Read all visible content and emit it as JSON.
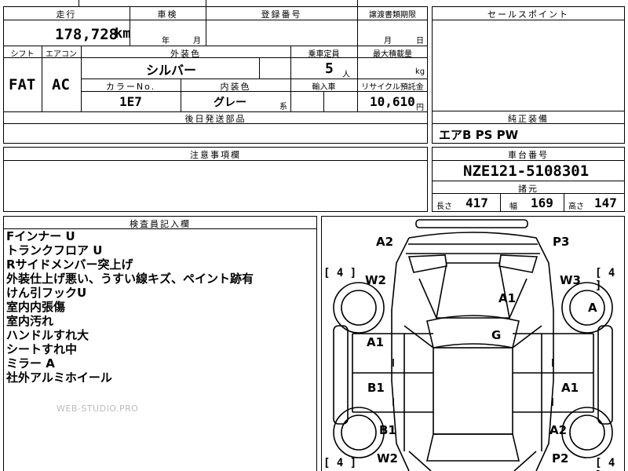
{
  "sheet": {
    "mileage_header": "走行",
    "mileage_value": "178,728",
    "mileage_unit": "km",
    "inspection_header": "車検",
    "inspection_year": "年",
    "inspection_month": "月",
    "plate_header": "登録番号",
    "transfer_header": "譲渡書類期限",
    "transfer_month": "月",
    "transfer_day": "日",
    "shift_header": "シフト",
    "shift_value": "FAT",
    "aircon_header": "エアコン",
    "aircon_value": "AC",
    "exterior_color_header": "外装色",
    "exterior_color_value": "シルバー",
    "capacity_header": "乗車定員",
    "capacity_value": "5",
    "capacity_unit": "人",
    "max_load_header": "最大積載量",
    "max_load_unit": "kg",
    "color_no_header": "カラーNo.",
    "color_no_value": "1E7",
    "interior_color_header": "内装色",
    "interior_color_value": "グレー",
    "interior_color_suffix": "系",
    "import_header": "輸入車",
    "recycle_header": "リサイクル預託金",
    "recycle_value": "10,610",
    "recycle_unit": "円",
    "later_parts_header": "後日発送部品",
    "sales_point_header": "セールスポイント",
    "factory_equipment_header": "純正装備",
    "factory_equipment_value": "エアB PS PW",
    "caution_header": "注意事項欄",
    "chassis_header": "車台番号",
    "chassis_value": "NZE121-5108301",
    "specs_header": "諸元",
    "length_label": "長さ",
    "length_value": "417",
    "width_label": "幅",
    "width_value": "169",
    "height_label": "高さ",
    "height_value": "147",
    "inspector_header": "検査員記入欄"
  },
  "inspector_notes": [
    "Fインナー U",
    "トランクフロア U",
    "Rサイドメンバー突上げ",
    "外装仕上げ悪い、うすい線キズ、ペイント跡有",
    "けん引フックU",
    "室内内張傷",
    "室内汚れ",
    "ハンドルすれ大",
    "シートすれ中",
    "ミラー A",
    "社外アルミホイール"
  ],
  "watermark": "WEB-STUDIO.PRO",
  "diagram": {
    "marks": {
      "a2_front_left": "A2",
      "p3_front_right": "P3",
      "w2_front_left": "W2",
      "w3_front_right": "W3",
      "a_front_right_wheel": "A",
      "a1_hood": "A1",
      "g_windshield": "G",
      "a1_left_front_door": "A1",
      "b1_left_rear_door": "B1",
      "a1_right_rear_door": "A1",
      "b1_left_rear_wheel": "B1",
      "a2_right_rear": "A2",
      "w2_rear_left": "W2",
      "p2_rear_right": "P2"
    },
    "tread": {
      "front_left": "4",
      "front_right": "4",
      "rear_left": "4",
      "rear_right": "4"
    }
  }
}
